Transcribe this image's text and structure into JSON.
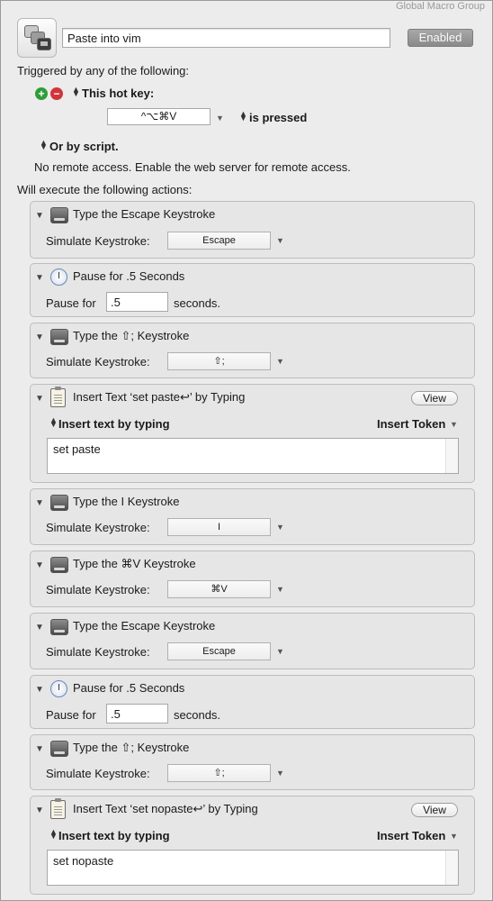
{
  "header": {
    "group_name": "Global Macro Group",
    "macro_name": "Paste into vim",
    "enabled_label": "Enabled",
    "macro_icon": "macro-icon"
  },
  "triggers": {
    "heading": "Triggered by any of the following:",
    "hotkey_label": "This hot key:",
    "hotkey_value": "^⌥⌘V",
    "hotkey_condition": "is pressed",
    "script_label": "Or by script.",
    "remote_text": "No remote access.  Enable the web server for remote access."
  },
  "actions_heading": "Will execute the following actions:",
  "common": {
    "simulate_label": "Simulate Keystroke:",
    "pause_label": "Pause for",
    "seconds_label": "seconds.",
    "view_label": "View",
    "insert_by_typing_label": "Insert text by typing",
    "insert_token_label": "Insert Token"
  },
  "actions": [
    {
      "title": "Type the Escape Keystroke",
      "key": "Escape"
    },
    {
      "title": "Pause for .5 Seconds",
      "value": ".5"
    },
    {
      "title": "Type the ⇧; Keystroke",
      "key": "⇧;"
    },
    {
      "title": "Insert Text ‘set paste↩’ by Typing",
      "text": "set paste"
    },
    {
      "title": "Type the I Keystroke",
      "key": "I"
    },
    {
      "title": "Type the ⌘V Keystroke",
      "key": "⌘V"
    },
    {
      "title": "Type the Escape Keystroke",
      "key": "Escape"
    },
    {
      "title": "Pause for .5 Seconds",
      "value": ".5"
    },
    {
      "title": "Type the ⇧; Keystroke",
      "key": "⇧;"
    },
    {
      "title": "Insert Text ‘set nopaste↩’ by Typing",
      "text": "set nopaste"
    }
  ]
}
